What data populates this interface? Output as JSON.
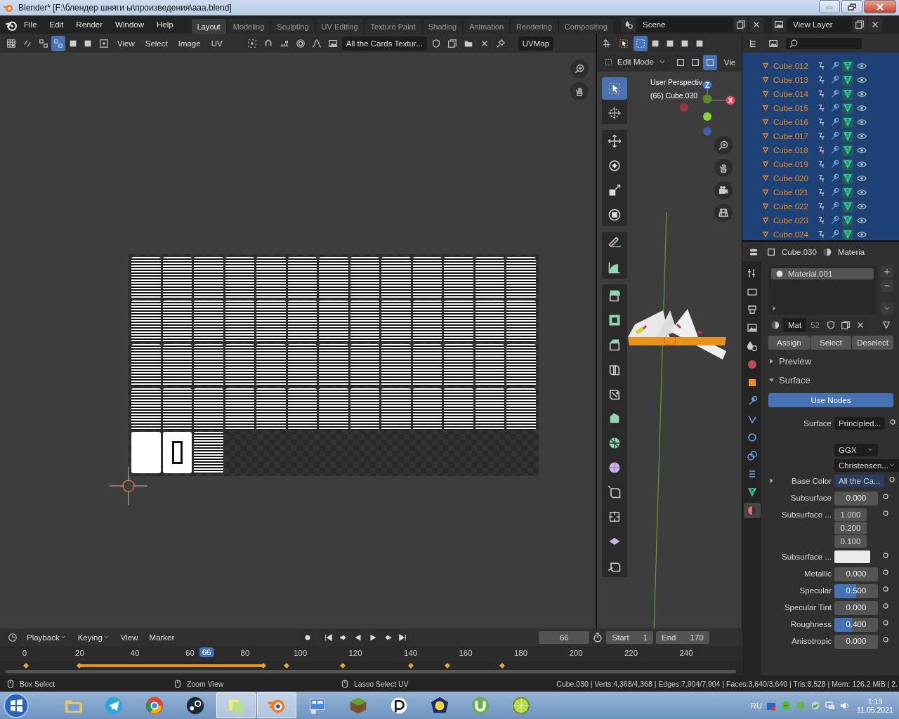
{
  "window": {
    "title": "Blender* [F:\\блендер шняги ы\\произведения\\aaa.blend]"
  },
  "menu": [
    "File",
    "Edit",
    "Render",
    "Window",
    "Help"
  ],
  "workspaces": [
    {
      "label": "Layout",
      "selected": true
    },
    {
      "label": "Modeling",
      "selected": false
    },
    {
      "label": "Sculpting",
      "selected": false
    },
    {
      "label": "UV Editing",
      "selected": false
    },
    {
      "label": "Texture Paint",
      "selected": false
    },
    {
      "label": "Shading",
      "selected": false
    },
    {
      "label": "Animation",
      "selected": false
    },
    {
      "label": "Rendering",
      "selected": false
    },
    {
      "label": "Compositing",
      "selected": false
    }
  ],
  "scene": {
    "name": "Scene"
  },
  "view_layer": {
    "name": "View Layer"
  },
  "uv_editor": {
    "select_modes": [
      {
        "selected": false
      },
      {
        "selected": true
      },
      {
        "selected": false
      },
      {
        "selected": false
      }
    ],
    "menus": [
      "View",
      "Select",
      "Image",
      "UV"
    ],
    "image_name": "All the Cards Textur...",
    "uv_map": "UVMap"
  },
  "viewport": {
    "box_modes": [
      {
        "selected": true
      },
      {
        "selected": false
      },
      {
        "selected": false
      },
      {
        "selected": false
      },
      {
        "selected": false
      }
    ],
    "mode": "Edit Mode",
    "mesh_select": [
      {
        "selected": false
      },
      {
        "selected": false
      },
      {
        "selected": true
      }
    ],
    "view_menu": "Vie",
    "overlay": [
      "User Perspectiv",
      "(66) Cube.030"
    ],
    "axis_labels": [
      "Z",
      "X"
    ],
    "tools": [
      {
        "selected": true
      },
      {
        "selected": false
      },
      {
        "selected": false
      },
      {
        "selected": false
      },
      {
        "selected": false
      },
      {
        "selected": false
      },
      {
        "selected": false
      },
      {
        "selected": false
      },
      {
        "selected": false
      },
      {
        "selected": false
      },
      {
        "selected": false
      },
      {
        "selected": false
      },
      {
        "selected": false
      },
      {
        "selected": false
      },
      {
        "selected": false
      },
      {
        "selected": false
      },
      {
        "selected": false
      },
      {
        "selected": false
      },
      {
        "selected": false
      },
      {
        "selected": false
      }
    ]
  },
  "outliner": {
    "rows": [
      {
        "name": "Cube.012",
        "selected": true
      },
      {
        "name": "Cube.013",
        "selected": true
      },
      {
        "name": "Cube.014",
        "selected": true
      },
      {
        "name": "Cube.015",
        "selected": true
      },
      {
        "name": "Cube.016",
        "selected": true
      },
      {
        "name": "Cube.017",
        "selected": true
      },
      {
        "name": "Cube.018",
        "selected": true
      },
      {
        "name": "Cube.019",
        "selected": true
      },
      {
        "name": "Cube.020",
        "selected": true
      },
      {
        "name": "Cube.021",
        "selected": true
      },
      {
        "name": "Cube.022",
        "selected": true
      },
      {
        "name": "Cube.023",
        "selected": true
      },
      {
        "name": "Cube.024",
        "selected": true
      }
    ]
  },
  "properties": {
    "object": "Cube.030",
    "context": "Materia",
    "tabs": [
      {
        "selected": false
      },
      {
        "selected": false
      },
      {
        "selected": false
      },
      {
        "selected": false
      },
      {
        "selected": false
      },
      {
        "selected": false
      },
      {
        "selected": false
      },
      {
        "selected": false
      },
      {
        "selected": false
      },
      {
        "selected": false
      },
      {
        "selected": false
      },
      {
        "selected": false
      },
      {
        "selected": false
      },
      {
        "selected": true
      }
    ],
    "slots": [
      {
        "name": "Material.001",
        "selected": true
      }
    ],
    "material": {
      "name": "Mat",
      "users": "52"
    },
    "slot_buttons": [
      "Assign",
      "Select",
      "Deselect"
    ],
    "panels": [
      {
        "label": "Preview",
        "expanded": false
      },
      {
        "label": "Surface",
        "expanded": true
      }
    ],
    "use_nodes": "Use Nodes",
    "fields": [
      {
        "kind": "socket",
        "label": "Surface",
        "value": "Principled..."
      },
      {
        "kind": "gap"
      },
      {
        "kind": "dropdown",
        "value": "GGX"
      },
      {
        "kind": "dropdown",
        "value": "Christensen..."
      },
      {
        "kind": "linked",
        "label": "Base Color",
        "value": "All the Ca...",
        "expanded": false
      },
      {
        "kind": "slider",
        "label": "Subsurface",
        "value": "0.000",
        "level": 0
      },
      {
        "kind": "vector",
        "label": "Subsurface ...",
        "values": [
          "1.000",
          "0.200",
          "0.100"
        ]
      },
      {
        "kind": "color",
        "label": "Subsurface ...",
        "color": "#ececec"
      },
      {
        "kind": "slider",
        "label": "Metallic",
        "value": "0.000",
        "level": 0
      },
      {
        "kind": "slider",
        "label": "Specular",
        "value": "0.500",
        "level": 0.5
      },
      {
        "kind": "slider",
        "label": "Specular Tint",
        "value": "0.000",
        "level": 0
      },
      {
        "kind": "slider",
        "label": "Roughness",
        "value": "0.400",
        "level": 0.4
      },
      {
        "kind": "slider",
        "label": "Anisotropic",
        "value": "0.000",
        "level": 0
      }
    ]
  },
  "timeline": {
    "menus": [
      {
        "label": "Playback",
        "dropdown": true
      },
      {
        "label": "Keying",
        "dropdown": true
      },
      {
        "label": "View",
        "dropdown": false
      },
      {
        "label": "Marker",
        "dropdown": false
      }
    ],
    "current_frame": "66",
    "frame_marker": "66",
    "start_label": "Start",
    "start": "1",
    "end_label": "End",
    "end": "170",
    "ticks": [
      "0",
      "20",
      "40",
      "60",
      "80",
      "100",
      "120",
      "140",
      "160",
      "180",
      "200",
      "220",
      "240"
    ]
  },
  "status_bar": {
    "hints": [
      "Box Select",
      "Zoom View",
      "Lasso Select UV"
    ],
    "stats": "Cube.030 | Verts:4,368/4,368 | Edges:7,904/7,904 | Faces:3,640/3,640 | Tris:8,528 | Mem: 126.2 MiB | 2."
  },
  "taskbar": {
    "apps": [
      {
        "selected": false
      },
      {
        "selected": false
      },
      {
        "selected": false
      },
      {
        "selected": false
      },
      {
        "selected": true
      },
      {
        "selected": true
      },
      {
        "selected": false
      },
      {
        "selected": false
      },
      {
        "selected": false
      },
      {
        "selected": false
      },
      {
        "selected": false
      },
      {
        "selected": false
      }
    ],
    "language": "RU",
    "time": "1:19",
    "date": "11.05.2021"
  }
}
